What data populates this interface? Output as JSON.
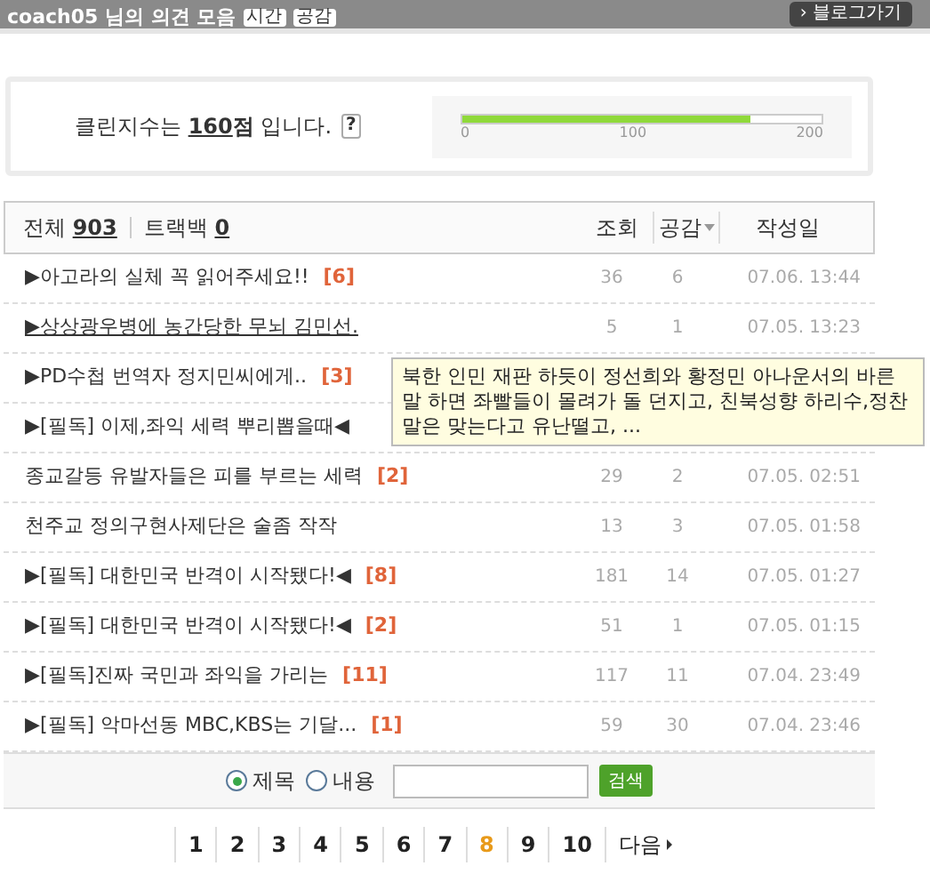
{
  "header": {
    "title": "coach05 님의 의견 모음",
    "badges": [
      "시간",
      "공감"
    ],
    "button": "› 블로그가기"
  },
  "clean_index": {
    "prefix": "클린지수는 ",
    "score": "160",
    "unit": "점",
    "suffix": " 입니다.",
    "help": "?",
    "level": 0.8,
    "ticks": [
      "0",
      "100",
      "200"
    ]
  },
  "summary": {
    "total_label": "전체",
    "total": "903",
    "trackback_label": "트랙백",
    "trackback": "0"
  },
  "columns": [
    "조회",
    "공감",
    "작성일"
  ],
  "rows": [
    {
      "title": "▶아고라의 실체 꼭 읽어주세요!!",
      "comments": "[6]",
      "views": "36",
      "likes": "6",
      "date": "07.06. 13:44",
      "hovered": false
    },
    {
      "title": "▶상상광우병에 농간당한 무뇌 김민선.",
      "views": "5",
      "likes": "1",
      "date": "07.05. 13:23",
      "hovered": true
    },
    {
      "title": "▶PD수첩 번역자 정지민씨에게..",
      "comments": "[3]",
      "hovered": false
    },
    {
      "title": "▶[필독] 이제,좌익 세력 뿌리뽑을때◀",
      "hovered": false
    },
    {
      "title": "종교갈등 유발자들은 피를 부르는 세력",
      "comments": "[2]",
      "views": "29",
      "likes": "2",
      "date": "07.05. 02:51",
      "hovered": false
    },
    {
      "title": "천주교 정의구현사제단은 술좀 작작",
      "views": "13",
      "likes": "3",
      "date": "07.05. 01:58",
      "hovered": false
    },
    {
      "title": "▶[필독] 대한민국 반격이 시작됐다!◀",
      "comments": "[8]",
      "views": "181",
      "likes": "14",
      "date": "07.05. 01:27",
      "hovered": false
    },
    {
      "title": "▶[필독] 대한민국 반격이 시작됐다!◀",
      "comments": "[2]",
      "views": "51",
      "likes": "1",
      "date": "07.05. 01:15",
      "hovered": false
    },
    {
      "title": "▶[필독]진짜 국민과 좌익을 가리는",
      "comments": "[11]",
      "views": "117",
      "likes": "11",
      "date": "07.04. 23:49",
      "hovered": false
    },
    {
      "title": "▶[필독] 악마선동 MBC,KBS는 기달...",
      "comments": "[1]",
      "views": "59",
      "likes": "30",
      "date": "07.04. 23:46",
      "hovered": false
    }
  ],
  "tooltip": "북한 인민 재판 하듯이 정선희와 황정민 아나운서의 바른말 하면  좌빨들이 몰려가 돌 던지고, 친북성향 하리수,정찬말은 맞는다고 유난떨고,     ...",
  "search": {
    "options": [
      {
        "label": "제목",
        "selected": true
      },
      {
        "label": "내용",
        "selected": false
      }
    ],
    "button": "검색"
  },
  "pagination": {
    "pages": [
      {
        "label": "1",
        "selected": false
      },
      {
        "label": "2",
        "selected": false
      },
      {
        "label": "3",
        "selected": false
      },
      {
        "label": "4",
        "selected": false
      },
      {
        "label": "5",
        "selected": false
      },
      {
        "label": "6",
        "selected": false
      },
      {
        "label": "7",
        "selected": false
      },
      {
        "label": "8",
        "selected": true
      },
      {
        "label": "9",
        "selected": false
      },
      {
        "label": "10",
        "selected": false
      }
    ],
    "next": "다음"
  }
}
